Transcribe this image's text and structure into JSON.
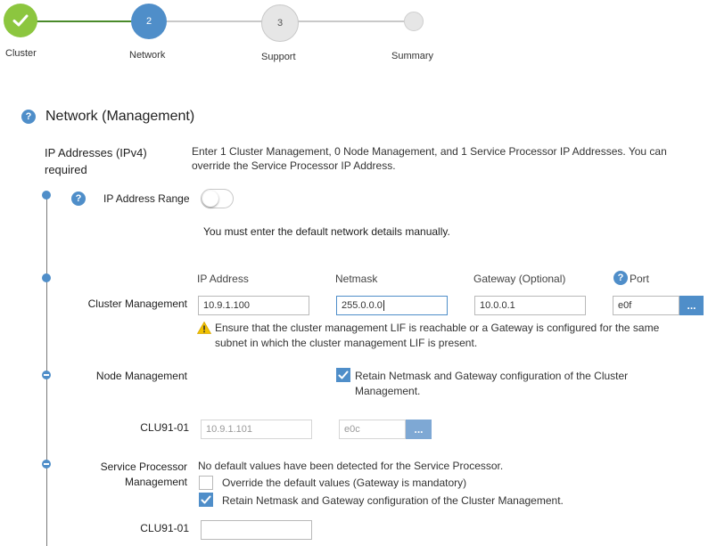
{
  "stepper": {
    "steps": [
      {
        "number": "",
        "label": "Cluster",
        "state": "done"
      },
      {
        "number": "2",
        "label": "Network",
        "state": "active"
      },
      {
        "number": "3",
        "label": "Support",
        "state": "pending"
      },
      {
        "number": "",
        "label": "Summary",
        "state": "pending"
      }
    ]
  },
  "section": {
    "title": "Network (Management)",
    "help_icon": "?"
  },
  "ip": {
    "heading_line1": "IP Addresses (IPv4)",
    "heading_line2": "required",
    "description": "Enter 1 Cluster Management, 0 Node Management, and 1 Service Processor IP Addresses. You can override the Service Processor IP Address."
  },
  "range": {
    "help_icon": "?",
    "label": "IP Address Range",
    "toggle_on": false,
    "manual_note": "You must enter the default network details manually."
  },
  "columns": {
    "ip": "IP Address",
    "netmask": "Netmask",
    "gateway": "Gateway (Optional)",
    "port_help": "?",
    "port": "Port"
  },
  "cluster_mgmt": {
    "label": "Cluster Management",
    "ip": "10.9.1.100",
    "netmask": "255.0.0.0",
    "gateway": "10.0.0.1",
    "port": "e0f",
    "browse": "...",
    "warning": "Ensure that the cluster management LIF is reachable or a Gateway is configured for the same subnet in which the cluster management LIF is present."
  },
  "node_mgmt": {
    "label": "Node Management",
    "retain_checked": true,
    "retain_label": "Retain Netmask and Gateway configuration of the Cluster Management.",
    "node_name": "CLU91-01",
    "ip": "10.9.1.101",
    "port": "e0c",
    "browse": "..."
  },
  "sp_mgmt": {
    "label_line1": "Service Processor",
    "label_line2": "Management",
    "note": "No default values have been detected for the Service Processor.",
    "override_checked": false,
    "override_label": "Override the default values (Gateway is mandatory)",
    "retain_checked": true,
    "retain_label": "Retain Netmask and Gateway configuration of the Cluster Management.",
    "node_name": "CLU91-01",
    "ip": ""
  },
  "colors": {
    "accent": "#4f8ec9",
    "done": "#8cc63f",
    "pending": "#e6e6e6",
    "warning": "#f2c200"
  }
}
